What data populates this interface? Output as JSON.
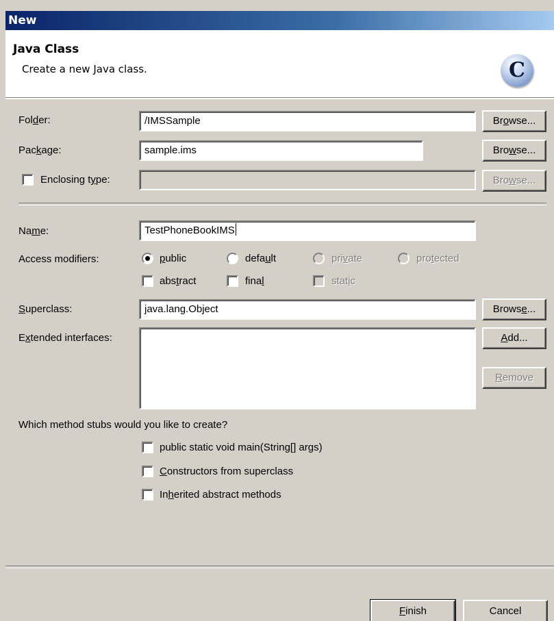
{
  "window": {
    "title": "New"
  },
  "header": {
    "title": "Java Class",
    "description": "Create a new Java class.",
    "icon_letter": "C"
  },
  "folder": {
    "label_pre": "Fol",
    "label_mn": "d",
    "label_post": "er:",
    "value": "/IMSSample",
    "browse_pre": "Br",
    "browse_mn": "o",
    "browse_post": "wse..."
  },
  "package": {
    "label_pre": "Pac",
    "label_mn": "k",
    "label_post": "age:",
    "value": "sample.ims",
    "browse_pre": "Bro",
    "browse_mn": "w",
    "browse_post": "se..."
  },
  "enclosing": {
    "label_pre": "Enclosing t",
    "label_mn": "y",
    "label_post": "pe:",
    "value": "",
    "browse_pre": "Bro",
    "browse_mn": "w",
    "browse_post": "se..."
  },
  "name": {
    "label_pre": "Na",
    "label_mn": "m",
    "label_post": "e:",
    "value": "TestPhoneBookIMS"
  },
  "access": {
    "label": "Access modifiers:",
    "public": {
      "pre": "",
      "mn": "p",
      "post": "ublic"
    },
    "default": {
      "pre": "defa",
      "mn": "u",
      "post": "lt"
    },
    "private": {
      "pre": "pri",
      "mn": "v",
      "post": "ate"
    },
    "protected": {
      "pre": "pro",
      "mn": "t",
      "post": "ected"
    },
    "abstract": {
      "pre": "abs",
      "mn": "t",
      "post": "ract"
    },
    "final": {
      "pre": "fina",
      "mn": "l",
      "post": ""
    },
    "static": {
      "pre": "stat",
      "mn": "i",
      "post": "c"
    }
  },
  "superclass": {
    "label_pre": "",
    "label_mn": "S",
    "label_post": "uperclass:",
    "value": "java.lang.Object",
    "browse_pre": "Brows",
    "browse_mn": "e",
    "browse_post": "..."
  },
  "interfaces": {
    "label_pre": "E",
    "label_mn": "x",
    "label_post": "tended interfaces:",
    "add_pre": "",
    "add_mn": "A",
    "add_post": "dd...",
    "remove_pre": "",
    "remove_mn": "R",
    "remove_post": "emove"
  },
  "stubs": {
    "question": "Which method stubs would you like to create?",
    "main": {
      "pre": "public static void main(Strin",
      "mn": "g",
      "post": "[] args)"
    },
    "constructors": {
      "pre": "",
      "mn": "C",
      "post": "onstructors from superclass"
    },
    "inherited": {
      "pre": "In",
      "mn": "h",
      "post": "erited abstract methods"
    }
  },
  "footer": {
    "finish_pre": "",
    "finish_mn": "F",
    "finish_post": "inish",
    "cancel": "Cancel"
  }
}
